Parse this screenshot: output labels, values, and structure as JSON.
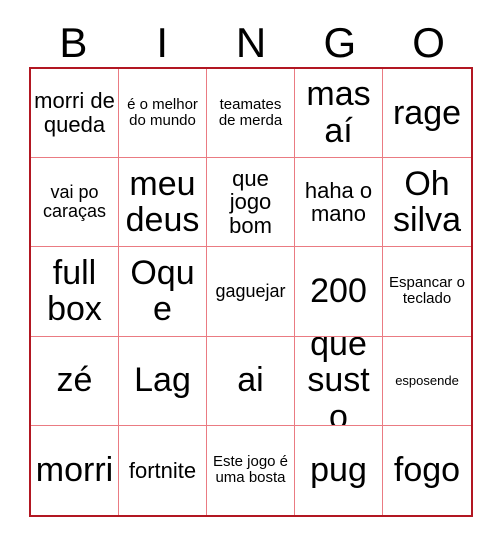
{
  "card": {
    "header_letters": [
      "B",
      "I",
      "N",
      "G",
      "O"
    ],
    "border_color": "#b21722",
    "gridline_color": "#ea7b82",
    "background_color": "#ffffff",
    "text_color": "#000000",
    "rows": 5,
    "columns": 5,
    "cells": [
      [
        {
          "text": "morri de queda",
          "size": "sz-md"
        },
        {
          "text": "é o melhor do mundo",
          "size": "sz-xs"
        },
        {
          "text": "teamates de merda",
          "size": "sz-xs"
        },
        {
          "text": "mas aí",
          "size": "sz-xl"
        },
        {
          "text": "rage",
          "size": "sz-xl"
        }
      ],
      [
        {
          "text": "vai po caraças",
          "size": "sz-sm"
        },
        {
          "text": "meu deus",
          "size": "sz-xl"
        },
        {
          "text": "que jogo bom",
          "size": "sz-md"
        },
        {
          "text": "haha o mano",
          "size": "sz-md"
        },
        {
          "text": "Oh silva",
          "size": "sz-xl"
        }
      ],
      [
        {
          "text": "full box",
          "size": "sz-xl"
        },
        {
          "text": "Oque",
          "size": "sz-xl"
        },
        {
          "text": "gaguejar",
          "size": "sz-sm"
        },
        {
          "text": "200",
          "size": "sz-xl"
        },
        {
          "text": "Espancar o teclado",
          "size": "sz-xs"
        }
      ],
      [
        {
          "text": "zé",
          "size": "sz-xl"
        },
        {
          "text": "Lag",
          "size": "sz-xl"
        },
        {
          "text": "ai",
          "size": "sz-xl"
        },
        {
          "text": "que susto",
          "size": "sz-xl"
        },
        {
          "text": "esposende",
          "size": "sz-xxs"
        }
      ],
      [
        {
          "text": "morri",
          "size": "sz-xl"
        },
        {
          "text": "fortnite",
          "size": "sz-md"
        },
        {
          "text": "Este jogo é uma bosta",
          "size": "sz-xs"
        },
        {
          "text": "pug",
          "size": "sz-xl"
        },
        {
          "text": "fogo",
          "size": "sz-xl"
        }
      ]
    ]
  }
}
